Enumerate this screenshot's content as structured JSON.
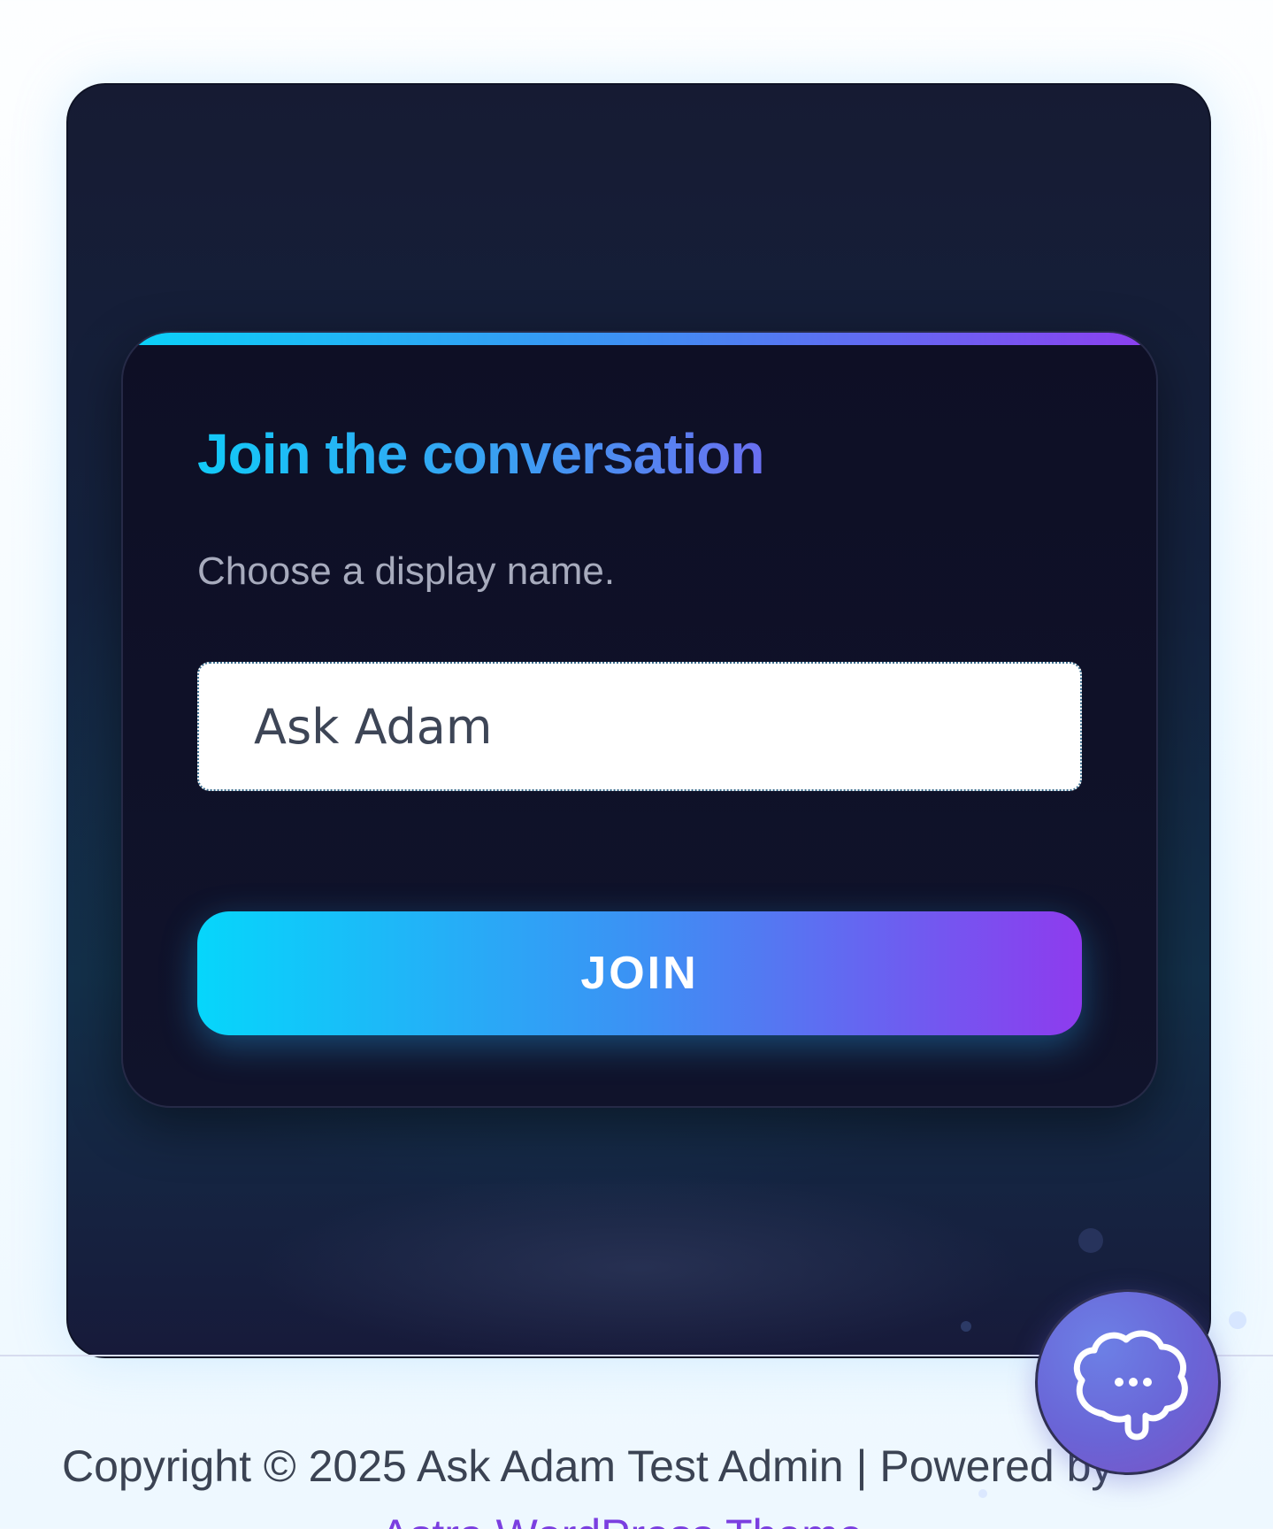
{
  "form": {
    "title": "Join the conversation",
    "subtitle": "Choose a display name.",
    "name_value": "Ask Adam",
    "join_label": "JOIN"
  },
  "footer": {
    "copyright": "Copyright © 2025 Ask Adam Test Admin | Powered by",
    "link_text": "Astra WordPress Theme"
  },
  "chat_widget": {
    "icon": "brain-chat-icon"
  },
  "colors": {
    "accent_start": "#06d6fb",
    "accent_mid": "#3c91f4",
    "accent_end": "#8e3bee",
    "card_bg": "#0e0f25",
    "footer_text": "#3b4353"
  }
}
